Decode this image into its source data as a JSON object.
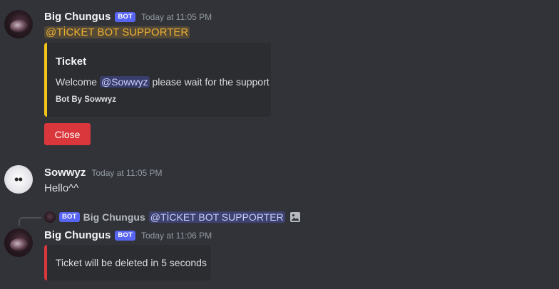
{
  "messages": [
    {
      "author": "Big Chungus",
      "badge": "BOT",
      "timestamp": "Today at 11:05 PM",
      "role_mention": "@TİCKET BOT SUPPORTER",
      "embed": {
        "title": "Ticket",
        "description_prefix": "Welcome",
        "user_mention": "@Sowwyz",
        "description_suffix": "please wait for the support",
        "footer": "Bot By Sowwyz",
        "color": "#f0c419"
      },
      "button": {
        "label": "Close",
        "color": "#da373c"
      }
    },
    {
      "author": "Sowwyz",
      "timestamp": "Today at 11:05 PM",
      "content": "Hello^^"
    },
    {
      "reply": {
        "badge": "BOT",
        "author": "Big Chungus",
        "mention": "@TİCKET BOT SUPPORTER",
        "attachment_icon": "image-icon"
      },
      "author": "Big Chungus",
      "badge": "BOT",
      "timestamp": "Today at 11:06 PM",
      "embed": {
        "description": "Ticket will be deleted in 5 seconds",
        "color": "#da373c"
      }
    }
  ],
  "colors": {
    "background": "#313338",
    "embed_background": "#2b2d31",
    "bot_badge": "#5865f2",
    "role_mention": "#f0b132"
  }
}
